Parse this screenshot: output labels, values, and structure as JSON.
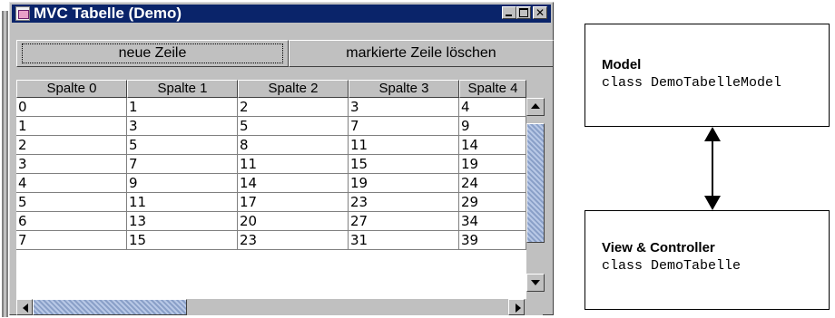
{
  "window": {
    "title": "MVC Tabelle (Demo)",
    "buttons": {
      "minimize": "minimize-icon",
      "maximize": "maximize-icon",
      "close": "✕"
    }
  },
  "toolbar": {
    "new_row_label": "neue Zeile",
    "delete_row_label": "markierte Zeile löschen"
  },
  "table": {
    "columns": [
      "Spalte 0",
      "Spalte 1",
      "Spalte 2",
      "Spalte 3",
      "Spalte 4"
    ],
    "rows": [
      [
        "0",
        "1",
        "2",
        "3",
        "4"
      ],
      [
        "1",
        "3",
        "5",
        "7",
        "9"
      ],
      [
        "2",
        "5",
        "8",
        "11",
        "14"
      ],
      [
        "3",
        "7",
        "11",
        "15",
        "19"
      ],
      [
        "4",
        "9",
        "14",
        "19",
        "24"
      ],
      [
        "5",
        "11",
        "17",
        "23",
        "29"
      ],
      [
        "6",
        "13",
        "20",
        "27",
        "34"
      ],
      [
        "7",
        "15",
        "23",
        "31",
        "39"
      ]
    ]
  },
  "colors": {
    "titlebar": "#0a246a",
    "window_bg": "#c0c0c0",
    "scroll_thumb": "#9bb0d4"
  },
  "diagram": {
    "model": {
      "title": "Model",
      "class": "class DemoTabelleModel"
    },
    "view": {
      "title": "View & Controller",
      "class": "class DemoTabelle"
    },
    "connector": "double-arrow"
  }
}
